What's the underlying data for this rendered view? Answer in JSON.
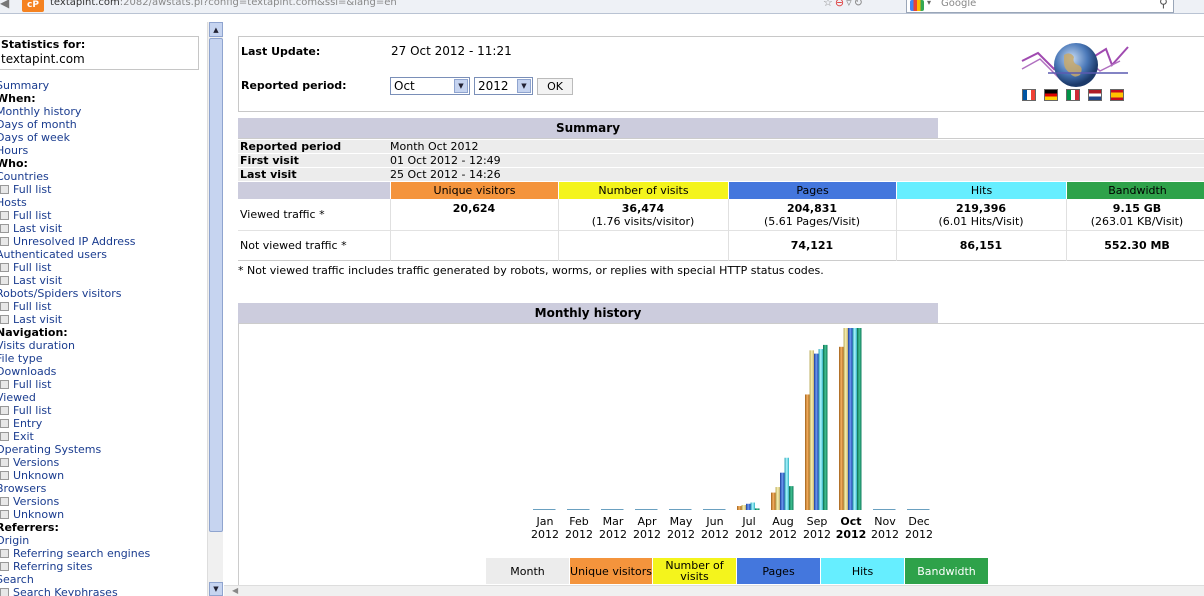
{
  "browser": {
    "url_host": "textapint.com",
    "url_rest": ":2082/awstats.pl?config=textapint.com&ssl=&lang=en",
    "favicon_text": "cP",
    "search_placeholder": "Google"
  },
  "menu": {
    "stats_label": "Statistics for:",
    "site": "textapint.com",
    "items": [
      {
        "label": "Summary",
        "type": "link"
      },
      {
        "label": "When:",
        "type": "head"
      },
      {
        "label": "Monthly history",
        "type": "link"
      },
      {
        "label": "Days of month",
        "type": "link"
      },
      {
        "label": "Days of week",
        "type": "link"
      },
      {
        "label": "Hours",
        "type": "link"
      },
      {
        "label": "Who:",
        "type": "head"
      },
      {
        "label": "Countries",
        "type": "link"
      },
      {
        "label": "Full list",
        "type": "sub"
      },
      {
        "label": "Hosts",
        "type": "link"
      },
      {
        "label": "Full list",
        "type": "sub"
      },
      {
        "label": "Last visit",
        "type": "sub"
      },
      {
        "label": "Unresolved IP Address",
        "type": "sub"
      },
      {
        "label": "Authenticated users",
        "type": "link"
      },
      {
        "label": "Full list",
        "type": "sub"
      },
      {
        "label": "Last visit",
        "type": "sub"
      },
      {
        "label": "Robots/Spiders visitors",
        "type": "link"
      },
      {
        "label": "Full list",
        "type": "sub"
      },
      {
        "label": "Last visit",
        "type": "sub"
      },
      {
        "label": "Navigation:",
        "type": "head"
      },
      {
        "label": "Visits duration",
        "type": "link"
      },
      {
        "label": "File type",
        "type": "link"
      },
      {
        "label": "Downloads",
        "type": "link"
      },
      {
        "label": "Full list",
        "type": "sub"
      },
      {
        "label": "Viewed",
        "type": "link"
      },
      {
        "label": "Full list",
        "type": "sub"
      },
      {
        "label": "Entry",
        "type": "sub"
      },
      {
        "label": "Exit",
        "type": "sub"
      },
      {
        "label": "Operating Systems",
        "type": "link"
      },
      {
        "label": "Versions",
        "type": "sub"
      },
      {
        "label": "Unknown",
        "type": "sub"
      },
      {
        "label": "Browsers",
        "type": "link"
      },
      {
        "label": "Versions",
        "type": "sub"
      },
      {
        "label": "Unknown",
        "type": "sub"
      },
      {
        "label": "Referrers:",
        "type": "head"
      },
      {
        "label": "Origin",
        "type": "link"
      },
      {
        "label": "Referring search engines",
        "type": "sub"
      },
      {
        "label": "Referring sites",
        "type": "sub"
      },
      {
        "label": "Search",
        "type": "link"
      },
      {
        "label": "Search Keyphrases",
        "type": "sub"
      }
    ]
  },
  "header": {
    "last_update_label": "Last Update:",
    "last_update_value": "27 Oct 2012 - 11:21",
    "reported_period_label": "Reported period:",
    "month_selected": "Oct",
    "year_selected": "2012",
    "ok_label": "OK"
  },
  "summary": {
    "title": "Summary",
    "rows": [
      {
        "key": "Reported period",
        "value": "Month Oct 2012"
      },
      {
        "key": "First visit",
        "value": "01 Oct 2012 - 12:49"
      },
      {
        "key": "Last visit",
        "value": "25 Oct 2012 - 14:26"
      }
    ],
    "columns": [
      "Unique visitors",
      "Number of visits",
      "Pages",
      "Hits",
      "Bandwidth"
    ],
    "viewed_label": "Viewed traffic *",
    "not_viewed_label": "Not viewed traffic *",
    "viewed": {
      "unique": "20,624",
      "visits": "36,474",
      "visits_sub": "(1.76 visits/visitor)",
      "pages": "204,831",
      "pages_sub": "(5.61 Pages/Visit)",
      "hits": "219,396",
      "hits_sub": "(6.01 Hits/Visit)",
      "bandwidth": "9.15 GB",
      "bandwidth_sub": "(263.01 KB/Visit)"
    },
    "not_viewed": {
      "pages": "74,121",
      "hits": "86,151",
      "bandwidth": "552.30 MB"
    },
    "footnote": "* Not viewed traffic includes traffic generated by robots, worms, or replies with special HTTP status codes."
  },
  "monthly_history": {
    "title": "Monthly history",
    "legend": [
      "Month",
      "Unique visitors",
      "Number of visits",
      "Pages",
      "Hits",
      "Bandwidth"
    ]
  },
  "colors": {
    "unique": "#f4943c",
    "visits": "#f4f41c",
    "pages": "#4477dd",
    "hits": "#66eeff",
    "bandwidth": "#2ea24a",
    "header_bg": "#ccccdd"
  },
  "chart_data": {
    "type": "bar",
    "title": "Monthly history",
    "categories": [
      "Jan",
      "Feb",
      "Mar",
      "Apr",
      "May",
      "Jun",
      "Jul",
      "Aug",
      "Sep",
      "Oct",
      "Nov",
      "Dec"
    ],
    "category_year": "2012",
    "highlighted_category": "Oct",
    "series": [
      {
        "name": "Unique visitors",
        "values": [
          0,
          0,
          0,
          0,
          0,
          0,
          500,
          2200,
          14600,
          20624,
          0,
          0
        ]
      },
      {
        "name": "Number of visits",
        "values": [
          0,
          0,
          0,
          0,
          0,
          0,
          1000,
          4600,
          32000,
          36474,
          0,
          0
        ]
      },
      {
        "name": "Pages",
        "values": [
          0,
          0,
          0,
          0,
          0,
          0,
          7000,
          42000,
          176000,
          204831,
          0,
          0
        ]
      },
      {
        "name": "Hits",
        "values": [
          0,
          0,
          0,
          0,
          0,
          0,
          9000,
          63000,
          194000,
          219396,
          0,
          0
        ]
      },
      {
        "name": "Bandwidth",
        "values": [
          0,
          0,
          0,
          0,
          0,
          0,
          0.08,
          1.2,
          8.3,
          9.15,
          0,
          0
        ]
      }
    ]
  }
}
